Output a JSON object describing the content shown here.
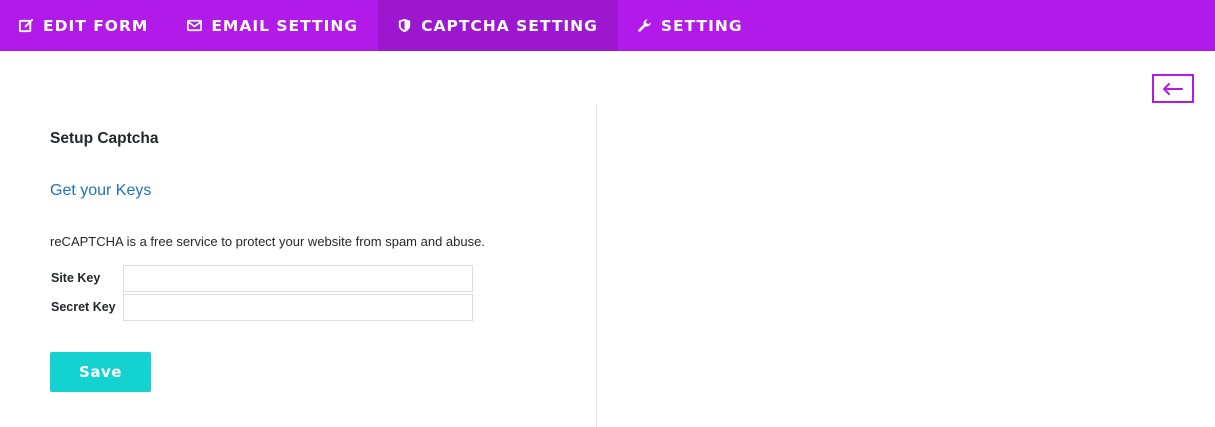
{
  "nav": {
    "tabs": [
      {
        "label": "EDIT FORM",
        "icon": "edit-icon",
        "active": false
      },
      {
        "label": "EMAIL SETTING",
        "icon": "envelope-icon",
        "active": false
      },
      {
        "label": "CAPTCHA SETTING",
        "icon": "shield-icon",
        "active": true
      },
      {
        "label": "SETTING",
        "icon": "wrench-icon",
        "active": false
      }
    ]
  },
  "back": {
    "icon": "arrow-left-icon"
  },
  "captcha": {
    "heading": "Setup Captcha",
    "keys_link": "Get your Keys",
    "description": "reCAPTCHA is a free service to protect your website from spam and abuse.",
    "site_key_label": "Site Key",
    "site_key_value": "",
    "secret_key_label": "Secret Key",
    "secret_key_value": "",
    "save_label": "Save"
  },
  "colors": {
    "nav_bg": "#b21aea",
    "nav_active": "#9c17cf",
    "link": "#1e73be",
    "save_bg": "#14d2cf"
  }
}
